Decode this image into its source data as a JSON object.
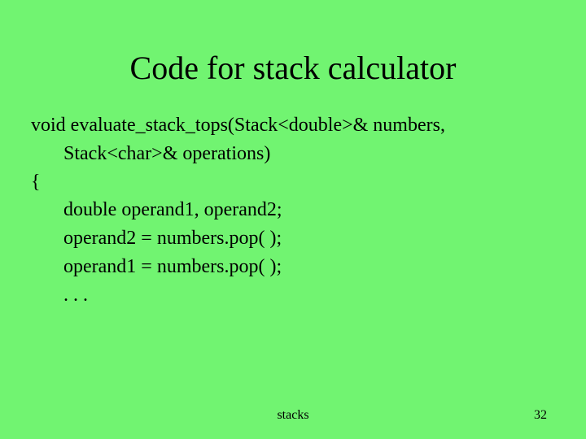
{
  "title": "Code for stack calculator",
  "code": {
    "l1": "void evaluate_stack_tops(Stack<double>& numbers,",
    "l2": "Stack<char>& operations)",
    "l3": "{",
    "l4": "double operand1, operand2;",
    "l5": "operand2 = numbers.pop( );",
    "l6": "operand1 = numbers.pop( );",
    "l7": ". . ."
  },
  "footer": {
    "center": "stacks",
    "page": "32"
  }
}
